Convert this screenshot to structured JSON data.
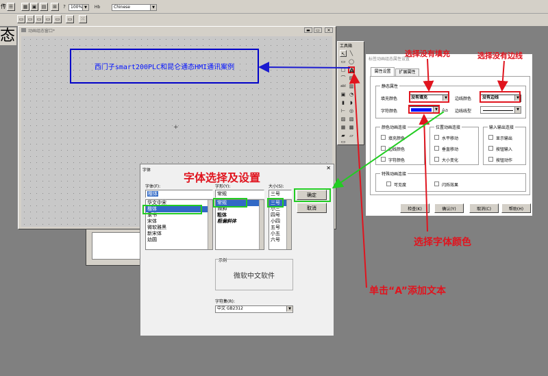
{
  "toolbar": {
    "zoom_value": "100%",
    "language_value": "Chinese",
    "frag_left": "传",
    "frag_state": "态",
    "hb_label": "Hb"
  },
  "canvas_window": {
    "title": "动画组态窗口*",
    "label_text": "西门子smart200PLC和昆仑通态HMI通讯案例"
  },
  "toolbox": {
    "title": "工具箱",
    "text_tool": "A",
    "abl_tool": "abl"
  },
  "props_dialog": {
    "title": "标签动画组态属性设置",
    "tabs": [
      "属性设置",
      "扩展属性"
    ],
    "static_group": "静态属性",
    "fill_color_label": "填充颜色",
    "fill_color_value": "没有填充",
    "border_color_label": "边线颜色",
    "border_color_value": "没有边线",
    "font_color_label": "字符颜色",
    "border_type_label": "边线线型",
    "color_anim_group": "颜色动画连接",
    "color_anim_items": [
      "填充颜色",
      "边线颜色",
      "字符颜色"
    ],
    "pos_anim_group": "位置动画连接",
    "pos_anim_items": [
      "水平移动",
      "垂直移动",
      "大小变化"
    ],
    "io_group": "输入输出连接",
    "io_items": [
      "显示输出",
      "按钮输入",
      "按钮动作"
    ],
    "special_group": "特殊动画连接",
    "special_items": [
      "可见度",
      "闪烁效果"
    ],
    "buttons": [
      "检查(K)",
      "确认(Y)",
      "取消(C)",
      "帮助(H)"
    ],
    "font_color_hex": "#0010ff"
  },
  "font_dialog": {
    "title": "字体",
    "font_label": "字体(F):",
    "font_value": "楷体",
    "font_list": [
      "华文中宋",
      "楷体",
      "隶书",
      "宋体",
      "微软雅黑",
      "新宋体",
      "幼圆"
    ],
    "style_label": "字形(Y):",
    "style_value": "常规",
    "style_list": [
      "常规",
      "倾斜",
      "粗体",
      "粗偏斜体"
    ],
    "size_label": "大小(S):",
    "size_value": "三号",
    "size_list": [
      "三号",
      "小三",
      "四号",
      "小四",
      "五号",
      "小五",
      "六号"
    ],
    "ok_button": "确定",
    "cancel_button": "取消",
    "sample_label": "示例",
    "sample_text": "微软中文软件",
    "charset_label": "字符集(R):",
    "charset_value": "中文 GB2312"
  },
  "annotations": {
    "no_fill": "选择没有填充",
    "no_border": "选择没有边线",
    "font_setup": "字体选择及设置",
    "font_color": "选择字体颜色",
    "click_a": "单击“A”添加文本"
  },
  "colors": {
    "annotation_red": "#e0141e",
    "highlight_green": "#22cc22",
    "label_box_blue": "#0000c8",
    "arrow_blue": "#1a1ad0"
  }
}
